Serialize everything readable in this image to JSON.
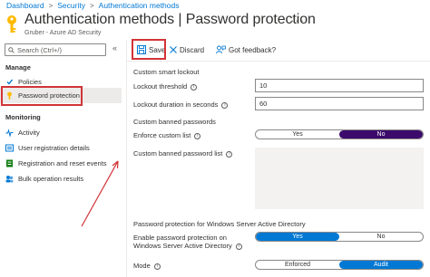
{
  "breadcrumb": [
    "Dashboard",
    "Security",
    "Authentication methods"
  ],
  "header": {
    "title": "Authentication methods | Password protection",
    "subtitle": "Gruber - Azure AD Security",
    "more": "···"
  },
  "sidebar": {
    "search_placeholder": "Search (Ctrl+/)",
    "collapse": "«",
    "manage_label": "Manage",
    "manage_items": [
      "Policies",
      "Password protection"
    ],
    "monitoring_label": "Monitoring",
    "monitoring_items": [
      "Activity",
      "User registration details",
      "Registration and reset events",
      "Bulk operation results"
    ]
  },
  "toolbar": {
    "save": "Save",
    "discard": "Discard",
    "feedback": "Got feedback?"
  },
  "form": {
    "lockout_section": "Custom smart lockout",
    "threshold_label": "Lockout threshold",
    "threshold_value": "10",
    "duration_label": "Lockout duration in seconds",
    "duration_value": "60",
    "banned_section": "Custom banned passwords",
    "enforce_label": "Enforce custom list",
    "enforce_yes": "Yes",
    "enforce_no": "No",
    "banned_list_label": "Custom banned password list",
    "windows_section": "Password protection for Windows Server Active Directory",
    "enable_label": "Enable password protection on Windows Server Active Directory",
    "enable_yes": "Yes",
    "enable_no": "No",
    "mode_label": "Mode",
    "mode_enforced": "Enforced",
    "mode_audit": "Audit"
  },
  "colors": {
    "accent": "#0078d4",
    "highlight": "#d13438",
    "toggle_on": "#3b0a6b"
  }
}
